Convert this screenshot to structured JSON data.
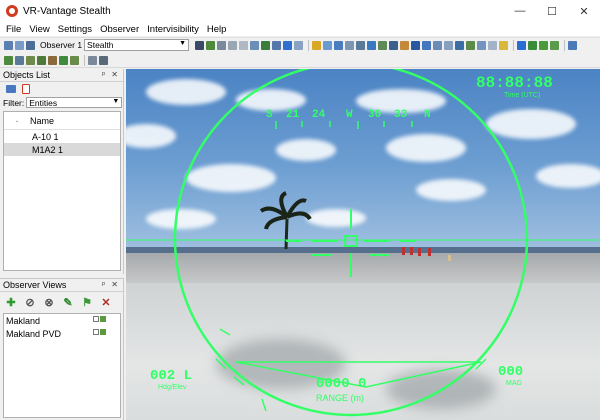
{
  "window": {
    "title": "VR-Vantage Stealth",
    "controls": {
      "minimize": "—",
      "maximize": "☐",
      "close": "✕"
    }
  },
  "menu": [
    "File",
    "View",
    "Settings",
    "Observer",
    "Intervisibility",
    "Help"
  ],
  "toolbar": {
    "observer_label": "Observer 1",
    "observer_value": "Stealth"
  },
  "objects_list": {
    "title": "Objects List",
    "filter_label": "Filter:",
    "filter_value": "Entities",
    "column_header": "Name",
    "items": [
      "A-10 1",
      "M1A2 1"
    ],
    "selected_index": 1
  },
  "observer_views": {
    "title": "Observer Views",
    "items": [
      "Makland",
      "Makland PVD"
    ]
  },
  "hud": {
    "clock": "88:88:88",
    "clock_sub": "Time (UTC)",
    "compass": [
      "S",
      "21",
      "24",
      "W",
      "30",
      "33",
      "N"
    ],
    "left_value": "002 L",
    "left_label": "Hdg/Elev",
    "right_value": "000",
    "right_label": "MAG",
    "range_value": "0000 0",
    "range_label": "RANGE (m)",
    "color": "#33ff66"
  },
  "colors": {
    "accent_red": "#d23a1f",
    "hud_green": "#33ff66"
  }
}
